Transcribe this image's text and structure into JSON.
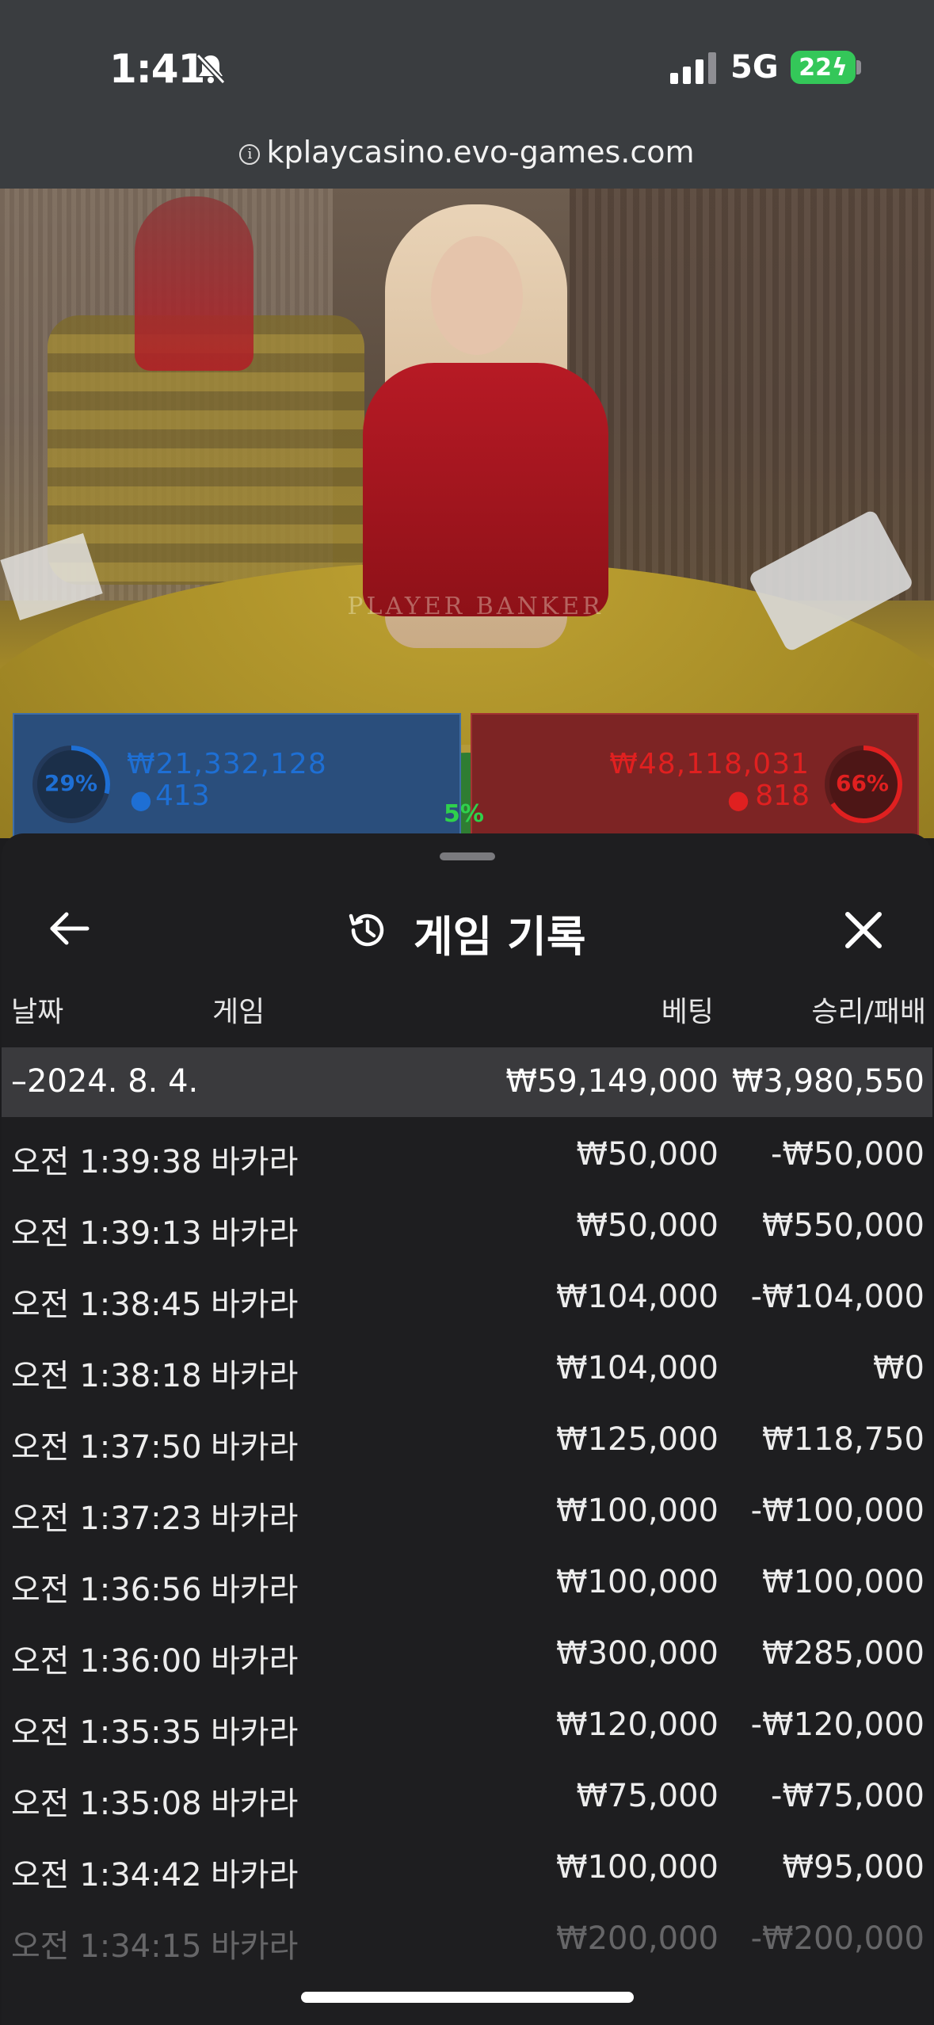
{
  "status_bar": {
    "time": "1:41",
    "network": "5G",
    "battery": "22"
  },
  "browser": {
    "url": "kplaycasino.evo-games.com"
  },
  "game_overlay": {
    "player": {
      "percent": "29%",
      "amount": "₩21,332,128",
      "players": "413",
      "color": "#1e6fd4"
    },
    "banker": {
      "percent": "66%",
      "amount": "₩48,118,031",
      "players": "818",
      "color": "#e02020"
    },
    "tie": {
      "percent": "5%",
      "color": "#2fd14c"
    },
    "table_text": "PLAYER        BANKER"
  },
  "history": {
    "title": "게임 기록",
    "columns": {
      "date": "날짜",
      "game": "게임",
      "bet": "베팅",
      "result": "승리/패배"
    },
    "date_group": {
      "date": "–2024. 8. 4.",
      "total_bet": "₩59,149,000",
      "total_result": "₩3,980,550"
    },
    "rows": [
      {
        "time": "오전 1:39:38",
        "game": "바카라",
        "bet": "₩50,000",
        "result": "-₩50,000"
      },
      {
        "time": "오전 1:39:13",
        "game": "바카라",
        "bet": "₩50,000",
        "result": "₩550,000"
      },
      {
        "time": "오전 1:38:45",
        "game": "바카라",
        "bet": "₩104,000",
        "result": "-₩104,000"
      },
      {
        "time": "오전 1:38:18",
        "game": "바카라",
        "bet": "₩104,000",
        "result": "₩0"
      },
      {
        "time": "오전 1:37:50",
        "game": "바카라",
        "bet": "₩125,000",
        "result": "₩118,750"
      },
      {
        "time": "오전 1:37:23",
        "game": "바카라",
        "bet": "₩100,000",
        "result": "-₩100,000"
      },
      {
        "time": "오전 1:36:56",
        "game": "바카라",
        "bet": "₩100,000",
        "result": "₩100,000"
      },
      {
        "time": "오전 1:36:00",
        "game": "바카라",
        "bet": "₩300,000",
        "result": "₩285,000"
      },
      {
        "time": "오전 1:35:35",
        "game": "바카라",
        "bet": "₩120,000",
        "result": "-₩120,000"
      },
      {
        "time": "오전 1:35:08",
        "game": "바카라",
        "bet": "₩75,000",
        "result": "-₩75,000"
      },
      {
        "time": "오전 1:34:42",
        "game": "바카라",
        "bet": "₩100,000",
        "result": "₩95,000"
      },
      {
        "time": "오전 1:34:15",
        "game": "바카라",
        "bet": "₩200,000",
        "result": "-₩200,000"
      }
    ]
  },
  "icons": {
    "back": "arrow-left-icon",
    "history": "history-clock-icon",
    "close": "close-icon",
    "info": "info-icon",
    "bell": "bell-slash-icon",
    "user": "user-icon"
  }
}
